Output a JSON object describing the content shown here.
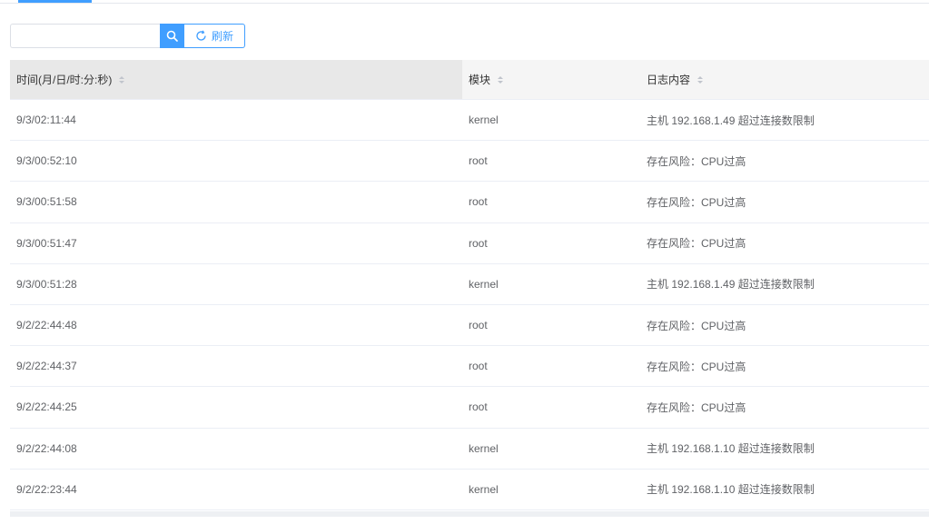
{
  "search": {
    "value": "",
    "placeholder": "",
    "refresh_label": "刷新"
  },
  "table": {
    "columns": [
      "时间(月/日/时:分:秒)",
      "模块",
      "日志内容"
    ],
    "rows": [
      [
        "9/3/02:11:44",
        "kernel",
        "主机 192.168.1.49 超过连接数限制"
      ],
      [
        "9/3/00:52:10",
        "root",
        "存在风险：CPU过高"
      ],
      [
        "9/3/00:51:58",
        "root",
        "存在风险：CPU过高"
      ],
      [
        "9/3/00:51:47",
        "root",
        "存在风险：CPU过高"
      ],
      [
        "9/3/00:51:28",
        "kernel",
        "主机 192.168.1.49 超过连接数限制"
      ],
      [
        "9/2/22:44:48",
        "root",
        "存在风险：CPU过高"
      ],
      [
        "9/2/22:44:37",
        "root",
        "存在风险：CPU过高"
      ],
      [
        "9/2/22:44:25",
        "root",
        "存在风险：CPU过高"
      ],
      [
        "9/2/22:44:08",
        "kernel",
        "主机 192.168.1.10 超过连接数限制"
      ],
      [
        "9/2/22:23:44",
        "kernel",
        "主机 192.168.1.10 超过连接数限制"
      ]
    ]
  },
  "icons": {
    "search": "search-icon",
    "refresh": "refresh-icon",
    "sort": "sort-icon"
  },
  "colors": {
    "accent": "#409eff",
    "header_bg": "#f5f5f5",
    "sorted_header_bg": "#e8e8e8",
    "text": "#606266"
  }
}
